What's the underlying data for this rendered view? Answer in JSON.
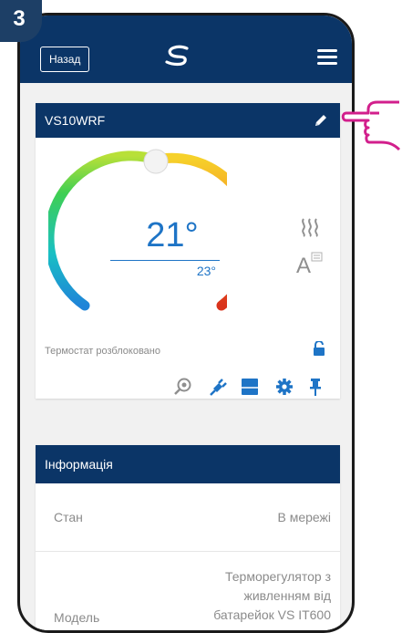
{
  "step_badge": "3",
  "topbar": {
    "back_label": "Назад",
    "logo_icon": "salus-logo-icon",
    "menu_icon": "hamburger-menu-icon"
  },
  "device_card": {
    "title": "VS10WRF",
    "edit_icon": "pencil-icon",
    "current_temp": "21°",
    "set_temp": "23°",
    "heating_icon": "heat-waves-icon",
    "mode_icon": "auto-mode-icon",
    "lock_status": "Термостат розблоковано",
    "lock_icon": "unlocked-padlock-icon",
    "actions": [
      "search-icon",
      "power-plug-icon",
      "schedule-icon",
      "gear-icon",
      "pin-icon"
    ],
    "colors": {
      "header": "#0b3567",
      "accent": "#1e74c6"
    }
  },
  "info_card": {
    "title": "Інформація",
    "rows": [
      {
        "label": "Стан",
        "value": "В мережі"
      },
      {
        "label": "Модель",
        "value_lines": [
          "Терморегулятор з",
          "живленням від",
          "батарейок VS IT600"
        ]
      }
    ]
  },
  "pointer": "pointing-hand-icon"
}
